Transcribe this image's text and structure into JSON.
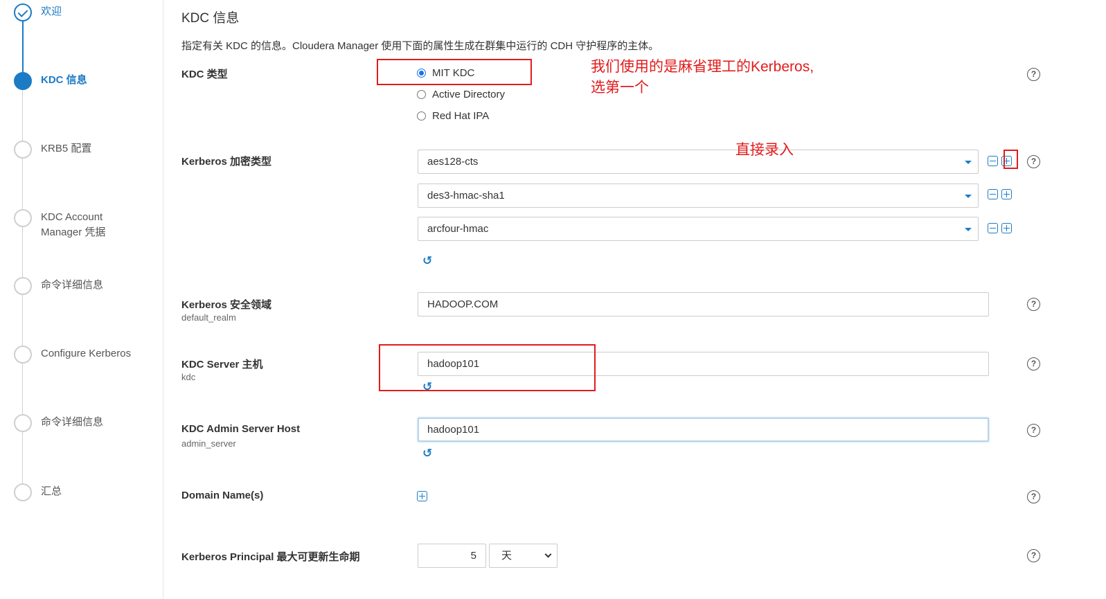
{
  "sidebar": {
    "steps": [
      {
        "label": "欢迎",
        "state": "done"
      },
      {
        "label": "KDC 信息",
        "state": "active"
      },
      {
        "label": "KRB5 配置",
        "state": "pending"
      },
      {
        "label_line1": "KDC Account",
        "label_line2": "Manager 凭据",
        "state": "pending"
      },
      {
        "label": "命令详细信息",
        "state": "pending"
      },
      {
        "label": "Configure Kerberos",
        "state": "pending"
      },
      {
        "label": "命令详细信息",
        "state": "pending"
      },
      {
        "label": "汇总",
        "state": "pending"
      }
    ]
  },
  "main": {
    "title": "KDC 信息",
    "description": "指定有关 KDC 的信息。Cloudera Manager 使用下面的属性生成在群集中运行的 CDH 守护程序的主体。",
    "kdc_type": {
      "label": "KDC 类型",
      "options": [
        "MIT KDC",
        "Active Directory",
        "Red Hat IPA"
      ],
      "selected": "MIT KDC"
    },
    "encryption": {
      "label": "Kerberos 加密类型",
      "values": [
        "aes128-cts",
        "des3-hmac-sha1",
        "arcfour-hmac"
      ]
    },
    "realm": {
      "label": "Kerberos 安全领域",
      "sub": "default_realm",
      "value": "HADOOP.COM"
    },
    "kdc_server": {
      "label": "KDC Server 主机",
      "sub": "kdc",
      "value": "hadoop101"
    },
    "admin_server": {
      "label": "KDC Admin Server Host",
      "sub": "admin_server",
      "value": "hadoop101"
    },
    "domain_names": {
      "label": "Domain Name(s)"
    },
    "max_renew": {
      "label": "Kerberos Principal 最大可更新生命期",
      "value": "5",
      "unit": "天"
    }
  },
  "annotations": {
    "kdc_note_line1": "我们使用的是麻省理工的Kerberos,",
    "kdc_note_line2": "选第一个",
    "enc_note": "直接录入"
  },
  "colors": {
    "accent": "#1c7bc4",
    "annotation": "#e21b1b"
  },
  "icons": {
    "help": "?",
    "undo": "↺"
  }
}
